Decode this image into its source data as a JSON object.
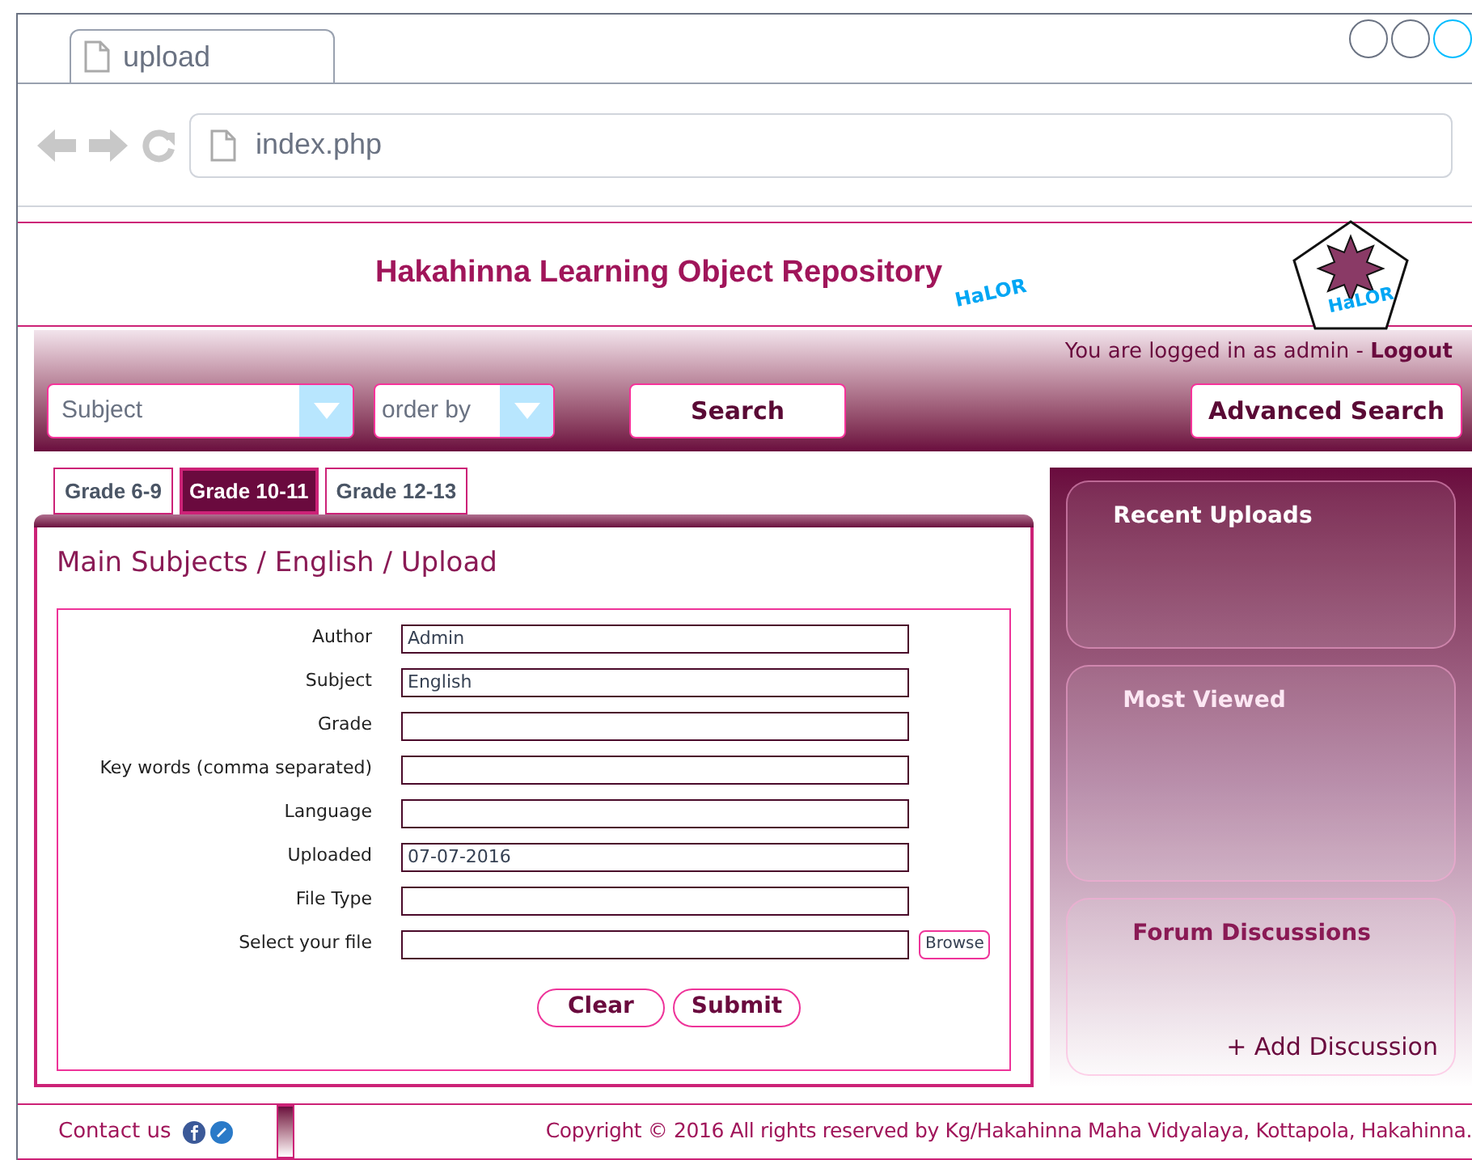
{
  "browser": {
    "tab": {
      "title": "upload"
    },
    "address": "index.php"
  },
  "header": {
    "title": "Hakahinna Learning Object Repository",
    "logo_text": "HaLOR",
    "badge_text": "HaLOR"
  },
  "login": {
    "text": "You are logged in as admin - ",
    "link": "Logout"
  },
  "toolbar": {
    "subject_placeholder": "Subject",
    "order_placeholder": "order by",
    "search": "Search",
    "advanced_search": "Advanced Search"
  },
  "grade_tabs": [
    {
      "label": "Grade 6-9",
      "selected": false
    },
    {
      "label": "Grade 10-11",
      "selected": true
    },
    {
      "label": "Grade 12-13",
      "selected": false
    }
  ],
  "breadcrumb": "Main Subjects / English / Upload",
  "form": {
    "fields": [
      {
        "label": "Author",
        "value": "Admin",
        "kind": "text"
      },
      {
        "label": "Subject",
        "value": "English",
        "kind": "text"
      },
      {
        "label": "Grade",
        "kind": "text"
      },
      {
        "label": "Key words (comma separated)",
        "kind": "text"
      },
      {
        "label": "Language",
        "kind": "text"
      },
      {
        "label": "Uploaded",
        "value": "07-07-2016",
        "kind": "text"
      },
      {
        "label": "File Type",
        "kind": "text"
      },
      {
        "label": "Select your file",
        "kind": "file",
        "browse": "Browse"
      }
    ],
    "buttons": [
      "Clear",
      "Submit"
    ]
  },
  "sidebar": {
    "panels": [
      {
        "title": "Recent Uploads"
      },
      {
        "title": "Most Viewed"
      },
      {
        "title": "Forum Discussions",
        "action": "+ Add Discussion"
      }
    ]
  },
  "footer": {
    "contact": "Contact us",
    "copyright": "Copyright © 2016 All rights reserved by Kg/Hakahinna Maha Vidyalaya, Kottapola, Hakahinna."
  }
}
